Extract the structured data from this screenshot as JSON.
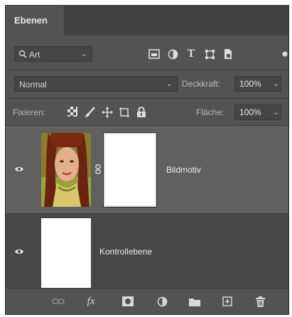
{
  "panel": {
    "tab_title": "Ebenen"
  },
  "filter": {
    "kind_label": "Art",
    "icons": [
      "pixel-filter-icon",
      "adjustment-filter-icon",
      "type-filter-icon",
      "shape-filter-icon",
      "smartobject-filter-icon"
    ]
  },
  "blend": {
    "mode": "Normal",
    "opacity_label": "Deckkraft:",
    "opacity_value": "100%"
  },
  "lock": {
    "label": "Fixieren:",
    "fill_label": "Fläche:",
    "fill_value": "100%"
  },
  "layers": [
    {
      "name": "Bildmotiv",
      "visible": true,
      "selected": true
    },
    {
      "name": "Kontrollebene",
      "visible": true,
      "selected": false
    }
  ],
  "footer": {
    "fx_label": "fx"
  },
  "colors": {
    "panel_bg": "#535353",
    "selected_layer": "#606060"
  }
}
